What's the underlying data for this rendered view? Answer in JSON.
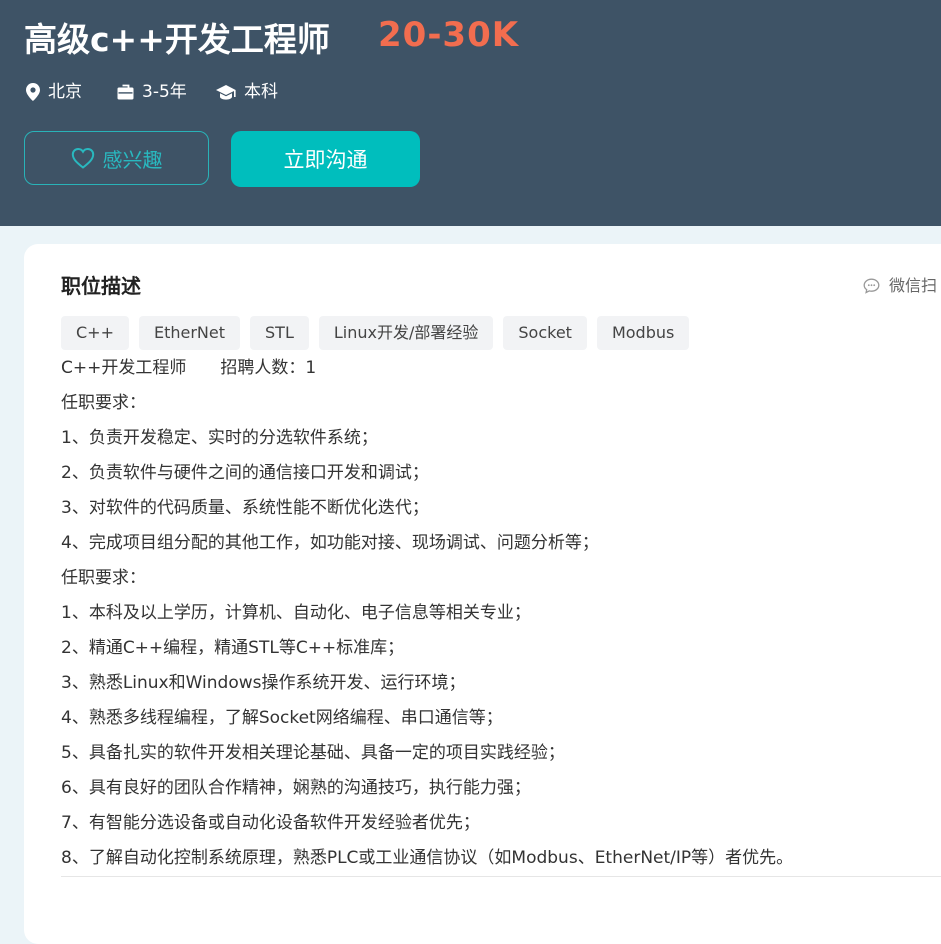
{
  "job": {
    "title": "高级c++开发工程师",
    "salary": "20-30K",
    "location": "北京",
    "experience": "3-5年",
    "education": "本科"
  },
  "actions": {
    "interest_label": "感兴趣",
    "chat_label": "立即沟通"
  },
  "description": {
    "section_title": "职位描述",
    "wechat_scan_label": "微信扫",
    "tags": [
      "C++",
      "EtherNet",
      "STL",
      "Linux开发/部署经验",
      "Socket",
      "Modbus"
    ],
    "lines": [
      "C++开发工程师　　招聘人数：1",
      "任职要求：",
      "1、负责开发稳定、实时的分选软件系统；",
      "2、负责软件与硬件之间的通信接口开发和调试；",
      "3、对软件的代码质量、系统性能不断优化迭代；",
      "4、完成项目组分配的其他工作，如功能对接、现场调试、问题分析等；",
      "任职要求：",
      "1、本科及以上学历，计算机、自动化、电子信息等相关专业；",
      "2、精通C++编程，精通STL等C++标准库；",
      "3、熟悉Linux和Windows操作系统开发、运行环境；",
      "4、熟悉多线程编程，了解Socket网络编程、串口通信等；",
      "5、具备扎实的软件开发相关理论基础、具备一定的项目实践经验；",
      "6、具有良好的团队合作精神，娴熟的沟通技巧，执行能力强；",
      "7、有智能分选设备或自动化设备软件开发经验者优先；",
      "8、了解自动化控制系统原理，熟悉PLC或工业通信协议（如Modbus、EtherNet/IP等）者优先。"
    ]
  },
  "icons": {
    "location": "location-pin-icon",
    "experience": "briefcase-icon",
    "education": "graduation-cap-icon",
    "interest": "heart-icon",
    "wechat": "chat-bubble-icon"
  },
  "colors": {
    "header_bg": "#3e5366",
    "salary": "#f26d4f",
    "accent": "#00bebd",
    "interest_border": "#29b3b8",
    "page_bg": "#ebf4f8"
  }
}
